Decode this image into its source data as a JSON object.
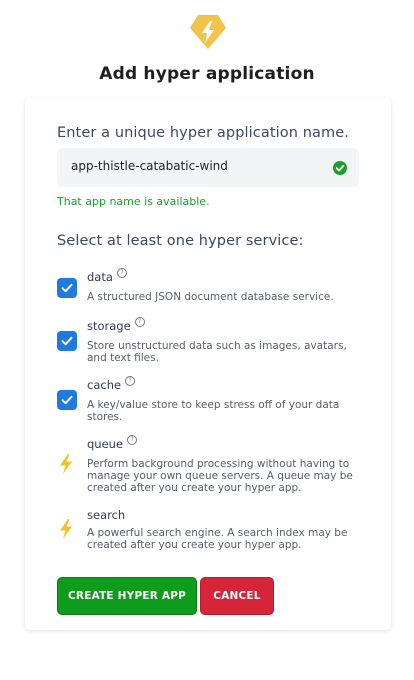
{
  "header": {
    "logo_icon": "hyper-bolt-logo-icon",
    "title": "Add hyper application"
  },
  "form": {
    "name_prompt": "Enter a unique hyper application name.",
    "name_value": "app-thistle-catabatic-wind",
    "name_status_icon": "check-circle-icon",
    "name_status_text": "That app name is available.",
    "services_heading": "Select at least one hyper service:",
    "help_glyph": "?",
    "services": [
      {
        "name": "data",
        "description": "A structured JSON document database service.",
        "checked": true,
        "icon": "checkbox-checked"
      },
      {
        "name": "storage",
        "description": "Store unstructured data such as images, avatars, and text files.",
        "checked": true,
        "icon": "checkbox-checked"
      },
      {
        "name": "cache",
        "description": "A key/value store to keep stress off of your data stores.",
        "checked": true,
        "icon": "checkbox-checked"
      },
      {
        "name": "queue",
        "description": "Perform background processing without having to manage your own queue servers. A queue may be created after you create your hyper app.",
        "checked": false,
        "icon": "lightning-bolt-icon"
      },
      {
        "name": "search",
        "description": "A powerful search engine. A search index may be created after you create your hyper app.",
        "checked": false,
        "icon": "lightning-bolt-icon"
      }
    ]
  },
  "actions": {
    "create_label": "CREATE HYPER APP",
    "cancel_label": "CANCEL"
  },
  "colors": {
    "accent_blue": "#1f7ae0",
    "success_green": "#1a9e2a",
    "create_button": "#0f9b1c",
    "cancel_button": "#d62438",
    "bolt_yellow": "#f2c12e"
  }
}
